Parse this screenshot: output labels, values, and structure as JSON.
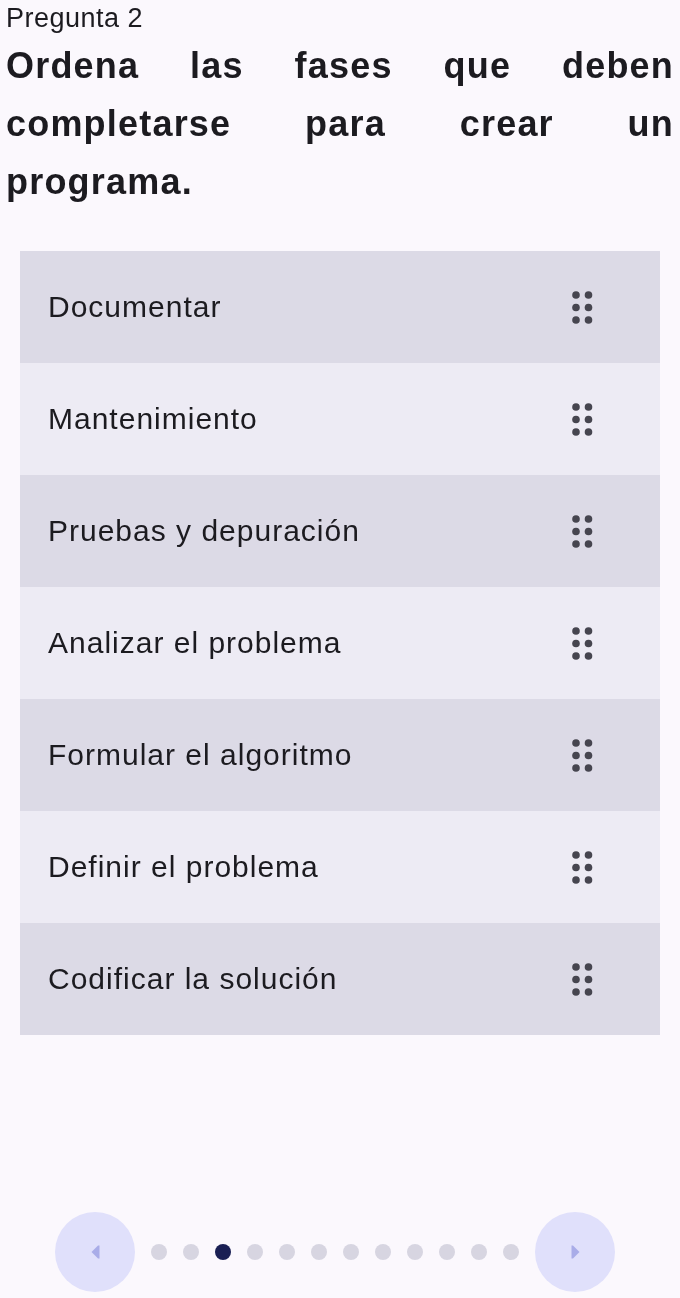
{
  "question_label": "Pregunta 2",
  "prompt": "Ordena las fases que deben completarse para crear un programa.",
  "items": [
    "Documentar",
    "Mantenimiento",
    "Pruebas y depuración",
    "Analizar el problema",
    "Formular el algoritmo",
    "Definir el problema",
    "Codificar la solución"
  ],
  "pagination": {
    "pages": [
      {
        "selected": false
      },
      {
        "selected": false
      },
      {
        "selected": true
      },
      {
        "selected": false
      },
      {
        "selected": false
      },
      {
        "selected": false
      },
      {
        "selected": false
      },
      {
        "selected": false
      },
      {
        "selected": false
      },
      {
        "selected": false
      },
      {
        "selected": false
      },
      {
        "selected": false
      }
    ]
  }
}
